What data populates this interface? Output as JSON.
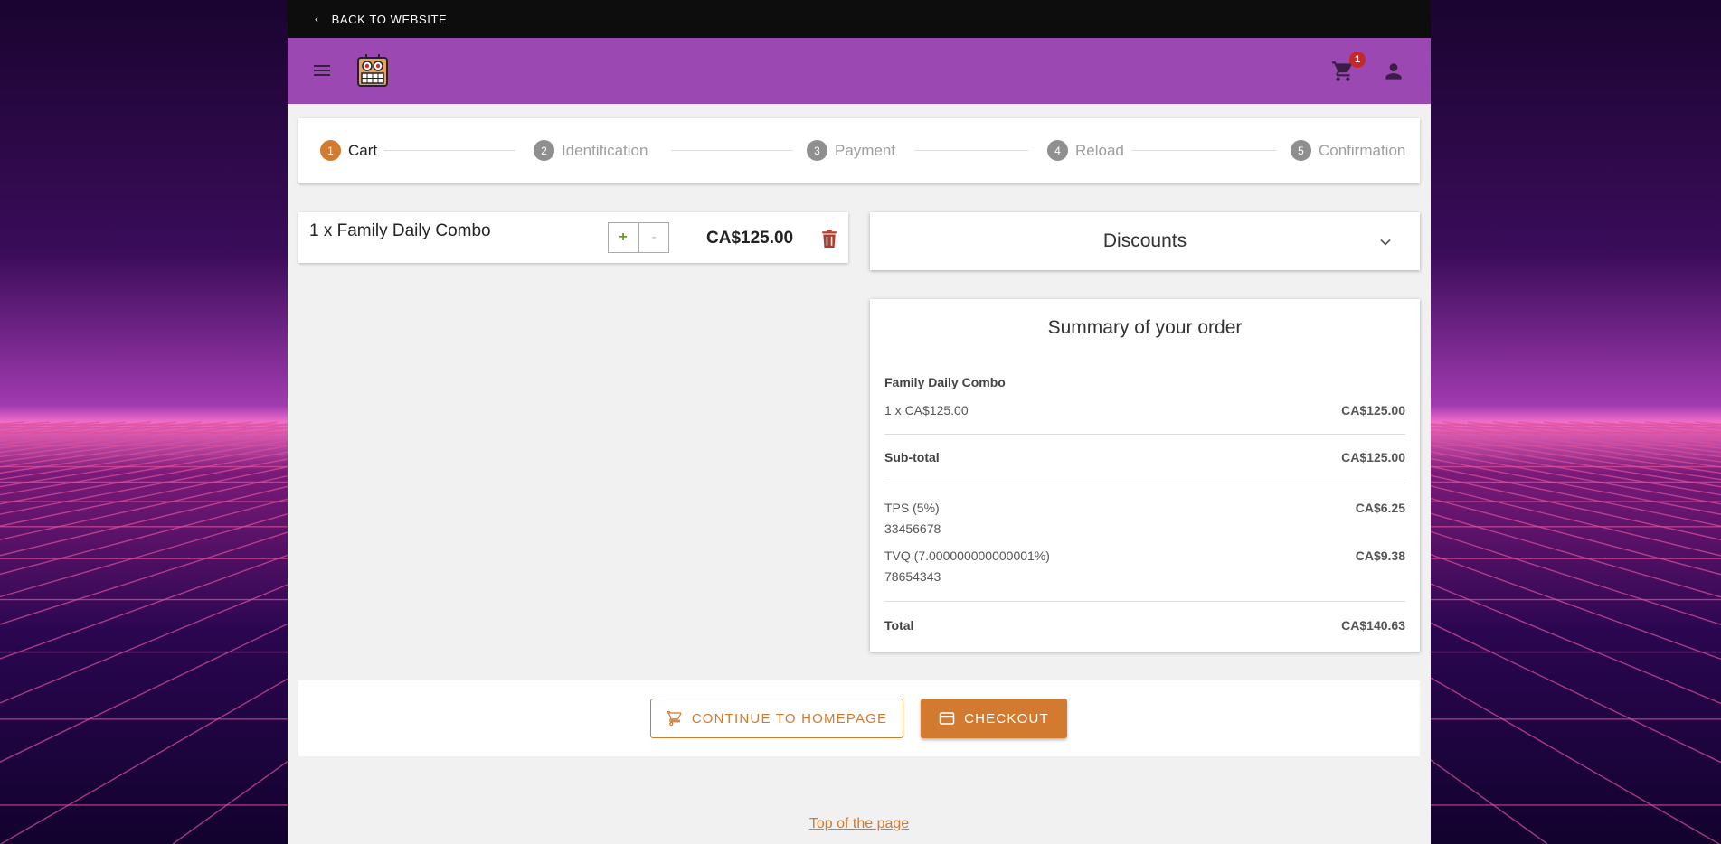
{
  "topbar": {
    "back_label": "BACK TO WEBSITE"
  },
  "header": {
    "cart_count": "1"
  },
  "steps": [
    {
      "num": "1",
      "label": "Cart"
    },
    {
      "num": "2",
      "label": "Identification"
    },
    {
      "num": "3",
      "label": "Payment"
    },
    {
      "num": "4",
      "label": "Reload"
    },
    {
      "num": "5",
      "label": "Confirmation"
    }
  ],
  "cart_item": {
    "name": "1 x Family Daily Combo",
    "plus": "+",
    "minus": "-",
    "price": "CA$125.00"
  },
  "discounts": {
    "title": "Discounts"
  },
  "summary": {
    "title": "Summary of your order",
    "item_name": "Family Daily Combo",
    "item_line": "1 x CA$125.00",
    "item_amount": "CA$125.00",
    "subtotal_label": "Sub-total",
    "subtotal_amount": "CA$125.00",
    "tps_label": "TPS (5%)",
    "tps_number": "33456678",
    "tps_amount": "CA$6.25",
    "tvq_label": "TVQ (7.000000000000001%)",
    "tvq_number": "78654343",
    "tvq_amount": "CA$9.38",
    "total_label": "Total",
    "total_amount": "CA$140.63"
  },
  "actions": {
    "continue_label": "CONTINUE TO HOMEPAGE",
    "checkout_label": "CHECKOUT"
  },
  "footer": {
    "top_link": "Top of the page"
  },
  "colors": {
    "header": "#9b48b2",
    "accent": "#d27a30",
    "badge": "#c62828",
    "trash": "#b23a2a"
  }
}
